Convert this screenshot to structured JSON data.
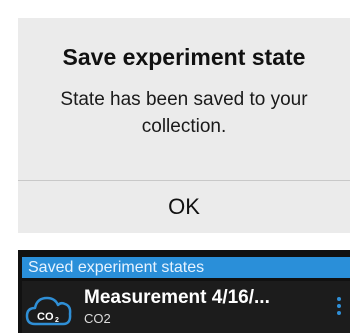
{
  "dialog": {
    "title": "Save experiment state",
    "message": "State has been saved to your collection.",
    "ok_label": "OK"
  },
  "saved_states": {
    "header": "Saved experiment states",
    "items": [
      {
        "title": "Measurement 4/16/...",
        "subtitle": "CO2",
        "icon": "co2-cloud-icon",
        "icon_label": "CO",
        "icon_subscript": "2",
        "menu_icon": "more-vertical-icon"
      }
    ]
  },
  "colors": {
    "dialog_background": "#ebebeb",
    "list_background": "#111111",
    "header_accent": "#2a8fd9",
    "icon_accent": "#2f8fd6"
  }
}
